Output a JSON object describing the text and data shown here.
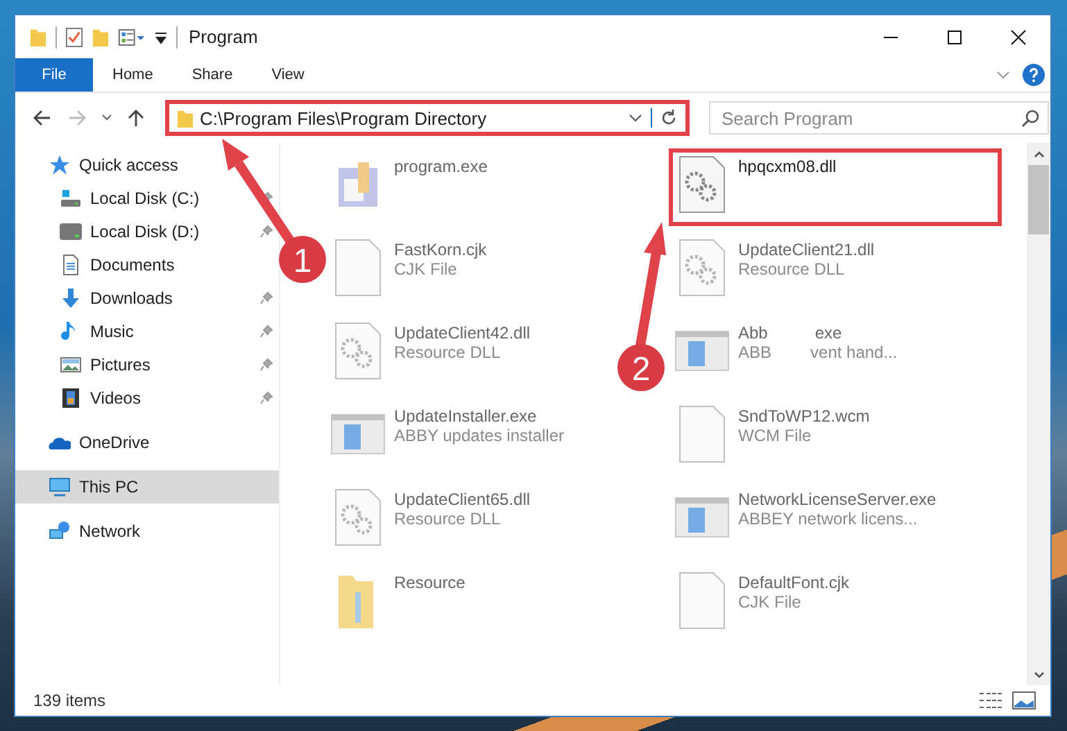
{
  "window": {
    "title": "Program"
  },
  "ribbon_tabs": [
    {
      "label": "File",
      "kind": "file"
    },
    {
      "label": "Home",
      "kind": "tab"
    },
    {
      "label": "Share",
      "kind": "tab"
    },
    {
      "label": "View",
      "kind": "tab"
    }
  ],
  "address_bar": {
    "path": "C:\\Program Files\\Program Directory",
    "highlighted": true
  },
  "search": {
    "placeholder": "Search Program"
  },
  "navigation": [
    {
      "label": "Quick access",
      "kind": "star",
      "selected": false,
      "children": [
        {
          "label": "Local Disk (C:)",
          "kind": "drive-win",
          "pinned": true,
          "selected": false
        },
        {
          "label": "Local Disk (D:)",
          "kind": "drive",
          "pinned": true,
          "selected": false
        },
        {
          "label": "Documents",
          "kind": "documents",
          "pinned": false,
          "selected": false
        },
        {
          "label": "Downloads",
          "kind": "downloads",
          "pinned": true,
          "selected": false
        },
        {
          "label": "Music",
          "kind": "music",
          "pinned": true,
          "selected": false
        },
        {
          "label": "Pictures",
          "kind": "pictures",
          "pinned": true,
          "selected": false
        },
        {
          "label": "Videos",
          "kind": "videos",
          "pinned": true,
          "selected": false
        }
      ]
    },
    {
      "label": "OneDrive",
      "kind": "cloud",
      "selected": false
    },
    {
      "label": "This PC",
      "kind": "pc",
      "selected": true
    },
    {
      "label": "Network",
      "kind": "network",
      "selected": false
    }
  ],
  "files": [
    {
      "name": "program.exe",
      "kind": "installer",
      "faded": true,
      "highlighted": false
    },
    {
      "name": "hpqcxm08.dll",
      "kind": "dll",
      "faded": false,
      "highlighted": true
    },
    {
      "name": "FastKorn.cjk",
      "type": "CJK File",
      "kind": "blank",
      "faded": true,
      "highlighted": false
    },
    {
      "name": "UpdateClient21.dll",
      "type": "Resource DLL",
      "kind": "dll",
      "faded": true,
      "highlighted": false
    },
    {
      "name": "UpdateClient42.dll",
      "type": "Resource DLL",
      "kind": "dll",
      "faded": true,
      "highlighted": false
    },
    {
      "name": "Abb",
      "name_tail": "exe",
      "type": "ABB",
      "type_tail": "vent hand...",
      "kind": "app",
      "faded": true,
      "highlighted": false
    },
    {
      "name": "UpdateInstaller.exe",
      "type": "ABBY updates installer",
      "kind": "app",
      "faded": true,
      "highlighted": false
    },
    {
      "name": "SndToWP12.wcm",
      "type": "WCM File",
      "kind": "blank",
      "faded": true,
      "highlighted": false
    },
    {
      "name": "UpdateClient65.dll",
      "type": "Resource DLL",
      "kind": "dll",
      "faded": true,
      "highlighted": false
    },
    {
      "name": "NetworkLicenseServer.exe",
      "type": "ABBEY network licens...",
      "kind": "app",
      "faded": true,
      "highlighted": false
    },
    {
      "name": "Resource",
      "kind": "folder",
      "faded": true,
      "highlighted": false
    },
    {
      "name": "DefaultFont.cjk",
      "type": "CJK File",
      "kind": "blank",
      "faded": true,
      "highlighted": false
    }
  ],
  "status_bar": {
    "item_count": "139 items"
  },
  "annotations": [
    {
      "number": "1"
    },
    {
      "number": "2"
    }
  ]
}
